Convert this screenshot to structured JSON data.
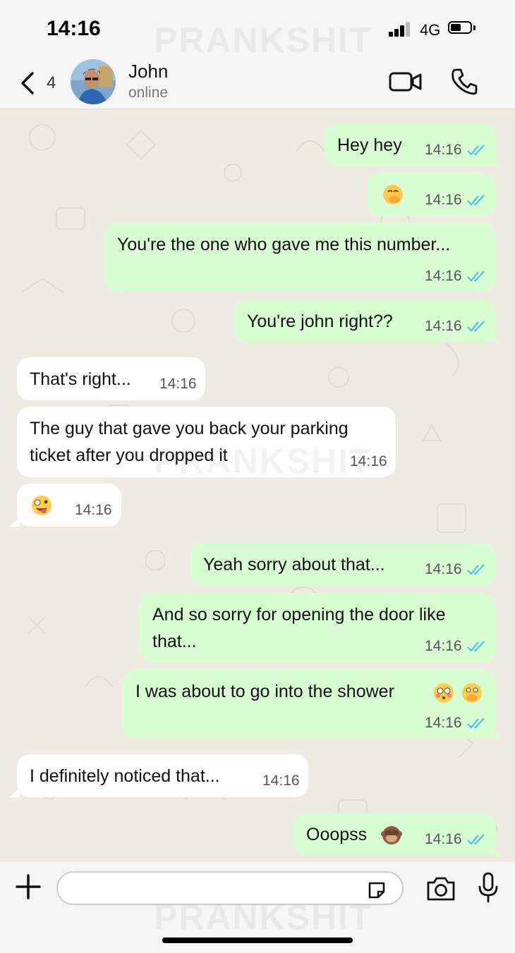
{
  "status_bar": {
    "time": "14:16",
    "network": "4G"
  },
  "watermark": "PRANKSHIT",
  "header": {
    "back_count": "4",
    "contact_name": "John",
    "contact_status": "online"
  },
  "messages": [
    {
      "dir": "out",
      "text": "Hey hey",
      "time": "14:16",
      "read": true
    },
    {
      "dir": "out",
      "emoji": "face-with-hand-over-mouth",
      "time": "14:16",
      "read": true
    },
    {
      "dir": "out",
      "text": "You're the one who gave me this number...",
      "time": "14:16",
      "read": true
    },
    {
      "dir": "out",
      "text": "You're john right??",
      "time": "14:16",
      "read": true
    },
    {
      "dir": "in",
      "text": "That's right...",
      "time": "14:16"
    },
    {
      "dir": "in",
      "text": "The guy that gave you back your parking ticket after you dropped it",
      "text_line1": "The guy that gave you back your parking",
      "text_line2": "ticket after you dropped it",
      "time": "14:16"
    },
    {
      "dir": "in",
      "emoji": "zany-face",
      "time": "14:16"
    },
    {
      "dir": "out",
      "text": "Yeah sorry about that...",
      "time": "14:16",
      "read": true
    },
    {
      "dir": "out",
      "text": "And so sorry for opening the door like that...",
      "text_line1": "And so sorry for opening the door like",
      "text_line2": "that...",
      "time": "14:16",
      "read": true
    },
    {
      "dir": "out",
      "text": "I was about to go into the shower",
      "emojis": [
        "flushed-face",
        "face-with-open-eyes-and-hand-over-mouth"
      ],
      "time": "14:16",
      "read": true
    },
    {
      "dir": "in",
      "text": "I definitely noticed that...",
      "time": "14:16"
    },
    {
      "dir": "out",
      "text": "Ooopss",
      "emoji": "see-no-evil-monkey",
      "time": "14:16",
      "read": true
    }
  ],
  "input": {
    "placeholder": ""
  },
  "colors": {
    "outgoing_bubble": "#d9fdd3",
    "incoming_bubble": "#ffffff",
    "read_ticks": "#53bdeb",
    "chat_bg": "#efeae2"
  }
}
